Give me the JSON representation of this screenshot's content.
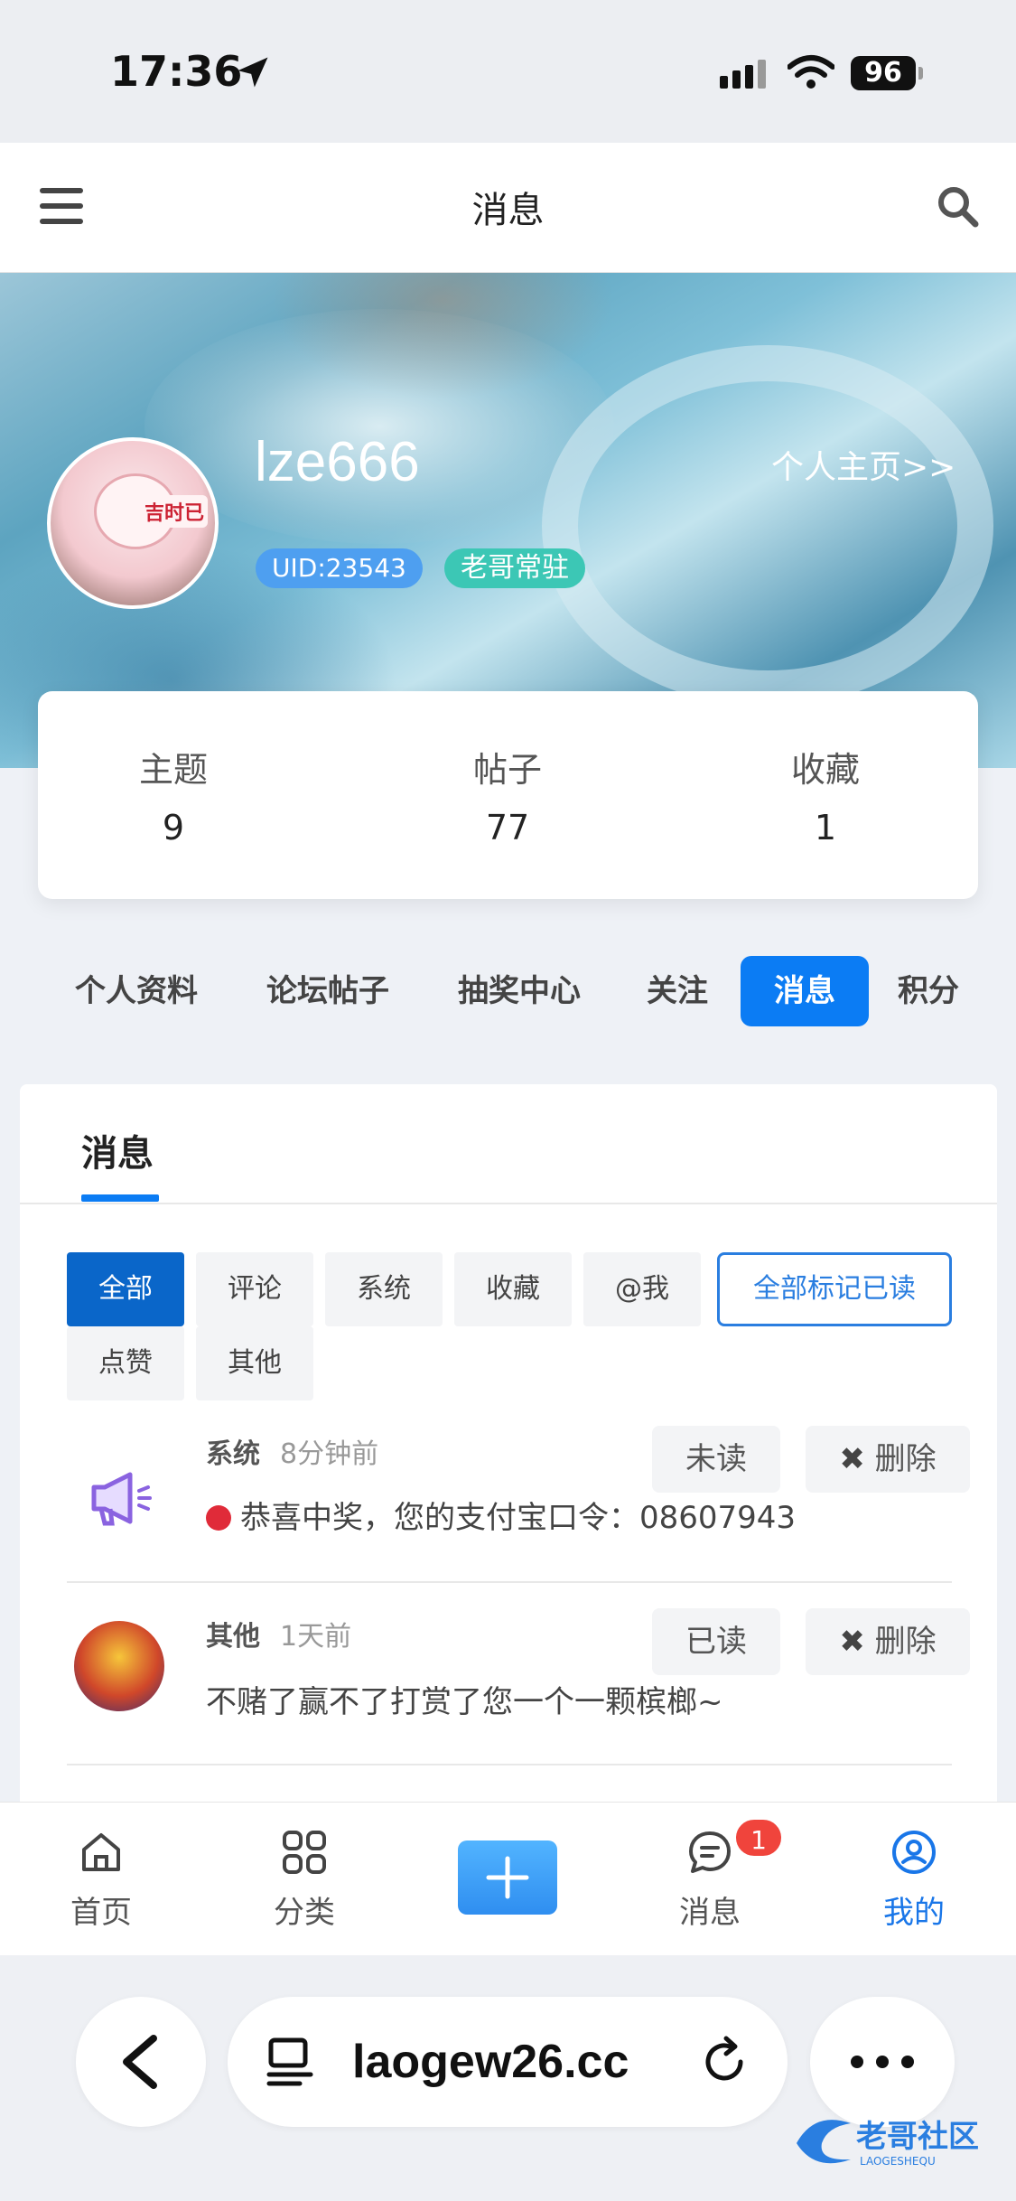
{
  "status_bar": {
    "time": "17:36",
    "battery": "96"
  },
  "header": {
    "title": "消息"
  },
  "profile": {
    "username": "lze666",
    "home_link": "个人主页>>",
    "uid": "UID:23543",
    "role": "老哥常驻",
    "avatar_tag": "吉时已"
  },
  "stats": [
    {
      "label": "主题",
      "value": "9"
    },
    {
      "label": "帖子",
      "value": "77"
    },
    {
      "label": "收藏",
      "value": "1"
    }
  ],
  "profile_tabs": [
    "个人资料",
    "论坛帖子",
    "抽奖中心",
    "关注",
    "消息",
    "积分"
  ],
  "active_profile_tab": "消息",
  "panel": {
    "title": "消息"
  },
  "filters": [
    "全部",
    "评论",
    "系统",
    "收藏",
    "@我",
    "点赞",
    "其他"
  ],
  "mark_all_read": "全部标记已读",
  "messages": [
    {
      "type": "系统",
      "time": "8分钟前",
      "text": "恭喜中奖，您的支付宝口令：08607943",
      "status_button": "未读",
      "delete_button": "删除"
    },
    {
      "type": "其他",
      "time": "1天前",
      "text": "不赌了赢不了打赏了您一个一颗槟榔~",
      "status_button": "已读",
      "delete_button": "删除"
    }
  ],
  "tabbar": {
    "items": [
      "首页",
      "分类",
      "消息",
      "我的"
    ],
    "message_badge": "1"
  },
  "browser": {
    "url": "laogew26.cc"
  },
  "watermark": {
    "text": "老哥社区",
    "sub": "LAOGESHEQU"
  },
  "colors": {
    "accent": "#0b7cf4",
    "badge_red": "#f0443c",
    "uid_blue": "#4e9ff0",
    "role_teal": "#3cc7b5"
  }
}
